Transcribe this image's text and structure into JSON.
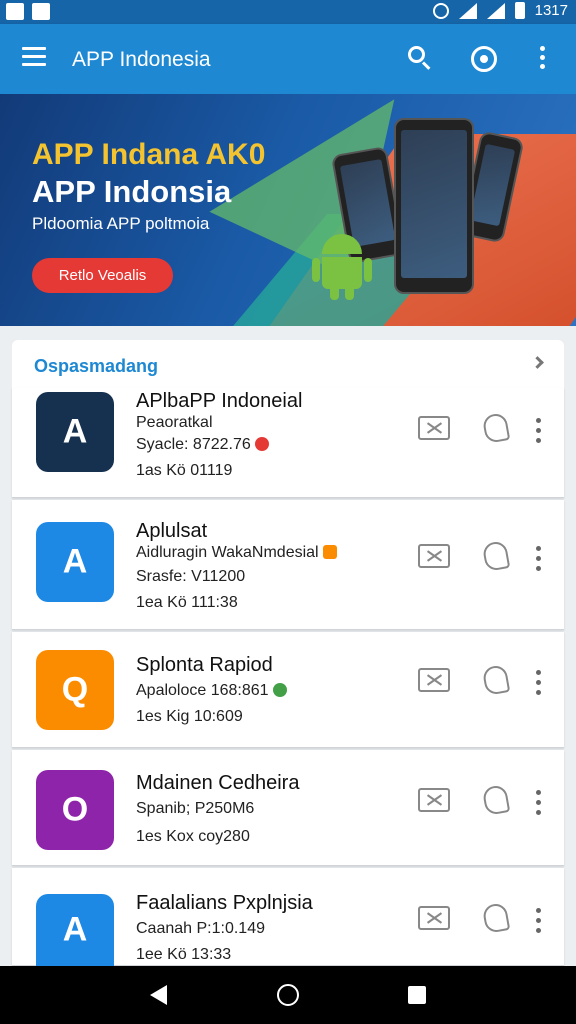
{
  "status_bar": {
    "time": "1317"
  },
  "app_bar": {
    "title": "APP Indonesia"
  },
  "banner": {
    "title_line1": "APP Indana AK0",
    "title_line2": "APP Indonsia",
    "subtitle": "Pldoomia APP poltmoia",
    "button": "Retlo Veoalis"
  },
  "section": {
    "title": "Ospasmadang"
  },
  "apps": [
    {
      "title": "APlbaPP Indoneial",
      "line2": "Peaoratkal",
      "line3": "Syacle: 8722.76",
      "line4": "1as Kö 01119",
      "icon_color": "#16304f",
      "badge_color": "#e53935"
    },
    {
      "title": "Aplulsat",
      "line2": "Aidluragin WakaNmdesial",
      "line3": "Srasfe: V11200",
      "line4": "1ea Kö 111:38",
      "icon_color": "#1e88e5",
      "badge_color": "#fb8c00"
    },
    {
      "title": "Splonta Rapiod",
      "line2": "Apaloloce 168:861",
      "line3": "",
      "line4": "1es Kig 10:609",
      "icon_color": "#fb8c00",
      "badge_color": "#43a047"
    },
    {
      "title": "Mdainen Cedheira",
      "line2": "Spanib; P250M6",
      "line3": "",
      "line4": "1es Kox coy280",
      "icon_color": "#8e24aa",
      "badge_color": ""
    },
    {
      "title": "Faalalians Pxplnjsia",
      "line2": "Caanah P:1:0.149",
      "line3": "",
      "line4": "1ee Kö 13:33",
      "icon_color": "#1e88e5",
      "badge_color": ""
    }
  ]
}
